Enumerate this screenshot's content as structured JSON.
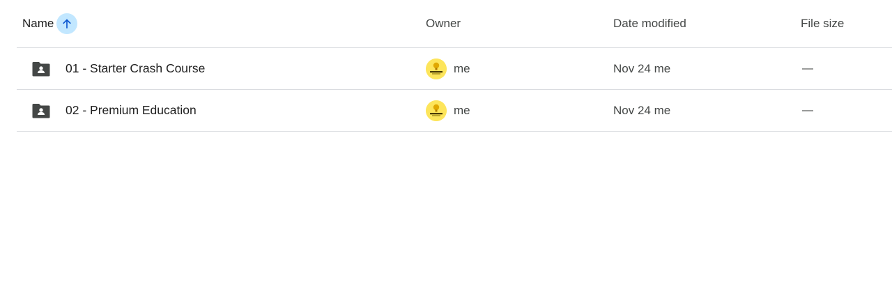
{
  "header": {
    "name_label": "Name",
    "owner_label": "Owner",
    "date_label": "Date modified",
    "size_label": "File size",
    "sort_icon": "arrow-upward-icon",
    "sort_direction": "ascending"
  },
  "rows": [
    {
      "icon": "shared-folder-icon",
      "name": "01 - Starter Crash Course",
      "owner": "me",
      "date_modified": "Nov 24 me",
      "file_size": "—"
    },
    {
      "icon": "shared-folder-icon",
      "name": "02 - Premium Education",
      "owner": "me",
      "date_modified": "Nov 24 me",
      "file_size": "—"
    }
  ],
  "colors": {
    "sort_button_bg": "#c2e7ff",
    "sort_arrow": "#0b57d0",
    "avatar_bg": "#fde55b",
    "divider": "#dadce0",
    "text_primary": "#1f1f1f",
    "text_secondary": "#444746"
  }
}
